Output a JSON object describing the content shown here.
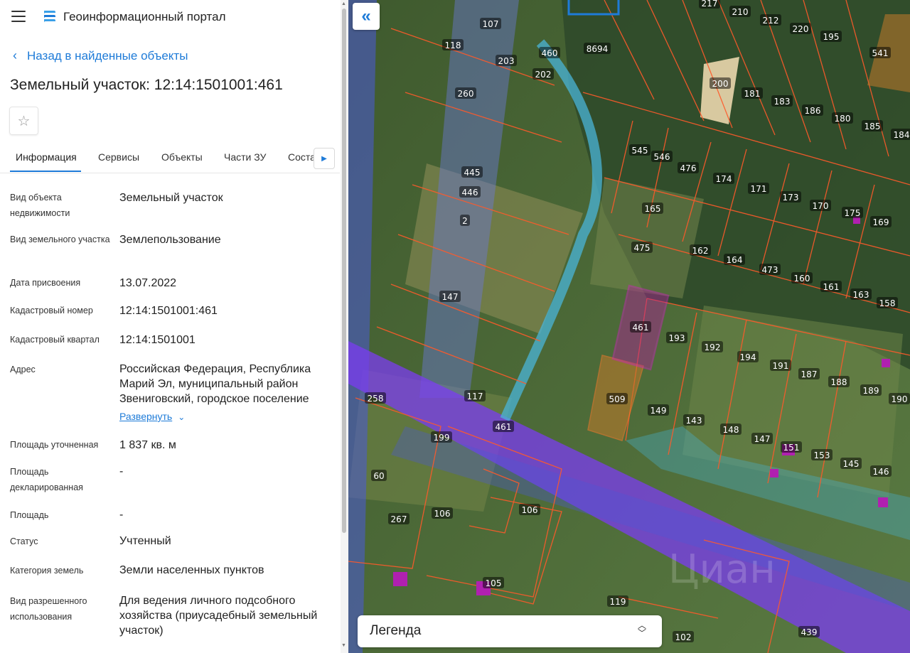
{
  "header": {
    "app_title": "Геоинформационный портал"
  },
  "back_link": {
    "label": "Назад в найденные объекты"
  },
  "object_title": "Земельный участок: 12:14:1501001:461",
  "tabs": [
    {
      "label": "Информация"
    },
    {
      "label": "Сервисы"
    },
    {
      "label": "Объекты"
    },
    {
      "label": "Части ЗУ"
    },
    {
      "label": "Соста"
    }
  ],
  "details": [
    {
      "label": "Вид объекта недвижимости",
      "value": "Земельный участок"
    },
    {
      "label": "Вид земельного участка",
      "value": "Землепользование"
    },
    {
      "label": "Дата присвоения",
      "value": "13.07.2022"
    },
    {
      "label": "Кадастровый номер",
      "value": "12:14:1501001:461"
    },
    {
      "label": "Кадастровый квартал",
      "value": "12:14:1501001"
    },
    {
      "label": "Адрес",
      "value": "Российская Федерация, Республика Марий Эл, муниципальный район Звениговский, городское поселение"
    },
    {
      "label": "Площадь уточненная",
      "value": "1 837 кв. м"
    },
    {
      "label": "Площадь декларированная",
      "value": "-"
    },
    {
      "label": "Площадь",
      "value": "-"
    },
    {
      "label": "Статус",
      "value": "Учтенный"
    },
    {
      "label": "Категория земель",
      "value": "Земли населенных пунктов"
    },
    {
      "label": "Вид разрешенного использования",
      "value": "Для ведения личного подсобного хозяйства (приусадебный земельный участок)"
    }
  ],
  "expand_label": "Развернуть",
  "legend": {
    "title": "Легенда"
  },
  "map_labels": [
    "107",
    "460",
    "8694",
    "217",
    "210",
    "212",
    "220",
    "195",
    "541",
    "118",
    "203",
    "202",
    "200",
    "181",
    "183",
    "186",
    "180",
    "185",
    "184",
    "260",
    "545",
    "546",
    "476",
    "174",
    "171",
    "173",
    "170",
    "175",
    "169",
    "445",
    "446",
    "165",
    "2",
    "475",
    "162",
    "164",
    "473",
    "160",
    "161",
    "163",
    "158",
    "147",
    "461",
    "193",
    "192",
    "194",
    "191",
    "187",
    "188",
    "189",
    "190",
    "258",
    "117",
    "509",
    "149",
    "143",
    "148",
    "147",
    "151",
    "153",
    "145",
    "146",
    "199",
    "461",
    "60",
    "106",
    "106",
    "267",
    "105",
    "119",
    "102",
    "439"
  ],
  "selected_parcel": "461",
  "colors": {
    "accent": "#1e7bd8",
    "parcel_border": "#ff5a2a",
    "selected": "#b0209a",
    "zone_purple": "#7b3cf0",
    "water_zone": "#49b4d8"
  }
}
